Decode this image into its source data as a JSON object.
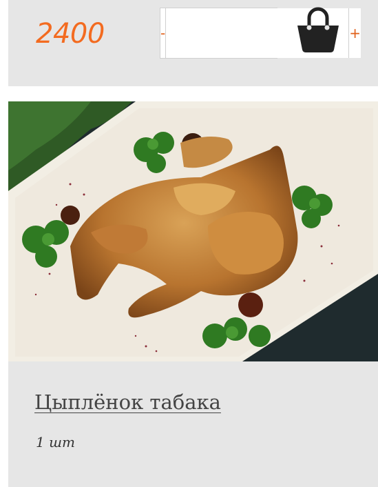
{
  "product": {
    "price": "2400",
    "name": "Цыплёнок табака",
    "portion": "1 шт",
    "accent_color": "#f36b20"
  },
  "quantity": {
    "minus_label": "-",
    "plus_label": "+",
    "value": ""
  },
  "icons": {
    "cart": "shopping-basket-icon"
  }
}
